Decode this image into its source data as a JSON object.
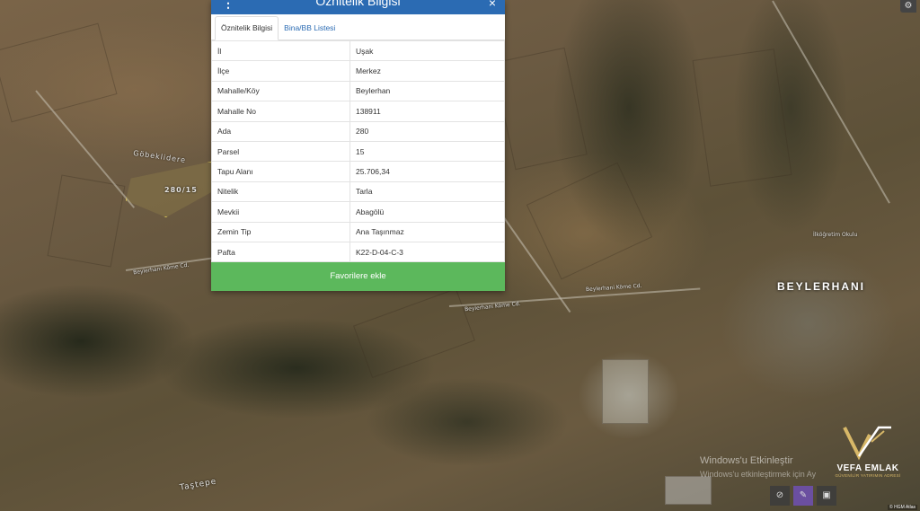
{
  "panel": {
    "title": "Öznitelik Bilgisi",
    "close_label": "×",
    "menu_label": "⋮",
    "tabs": [
      {
        "label": "Öznitelik Bilgisi",
        "active": true
      },
      {
        "label": "Bina/BB Listesi",
        "active": false
      }
    ],
    "rows": [
      {
        "key": "İl",
        "value": "Uşak"
      },
      {
        "key": "İlçe",
        "value": "Merkez"
      },
      {
        "key": "Mahalle/Köy",
        "value": "Beylerhan"
      },
      {
        "key": "Mahalle No",
        "value": "138911"
      },
      {
        "key": "Ada",
        "value": "280"
      },
      {
        "key": "Parsel",
        "value": "15"
      },
      {
        "key": "Tapu Alanı",
        "value": "25.706,34"
      },
      {
        "key": "Nitelik",
        "value": "Tarla"
      },
      {
        "key": "Mevkii",
        "value": "Abagölü"
      },
      {
        "key": "Zemin Tip",
        "value": "Ana Taşınmaz"
      },
      {
        "key": "Pafta",
        "value": "K22-D-04-C-3"
      }
    ],
    "favorite_button": "Favorilere ekle"
  },
  "map": {
    "parcel_label": "280/15",
    "village_label": "BEYLERHANI",
    "locality_label": "Göbeklidere",
    "locality_label_2": "Taştepe",
    "school_label": "İlköğretim Okulu",
    "road_labels": [
      "Beylerhani Köme Cd.",
      "Beylerhani Köme Cd.",
      "Beylerhani Köme Cd."
    ],
    "attribution": "© HGM Atlas"
  },
  "overlay": {
    "windows_title": "Windows'u Etkinleştir",
    "windows_sub": "Windows'u etkinleştirmek için Ay",
    "brand_name": "VEFA EMLAK",
    "brand_tagline": "GÜVENİLİR YATIRIMIN ADRESİ",
    "brand_color": "#d8b868"
  },
  "toolbar": {
    "settings_icon": "gear-icon",
    "tools": [
      {
        "icon": "eye-off-icon",
        "glyph": "⊘"
      },
      {
        "icon": "pen-icon",
        "glyph": "✎"
      },
      {
        "icon": "print-icon",
        "glyph": "▣"
      }
    ]
  }
}
